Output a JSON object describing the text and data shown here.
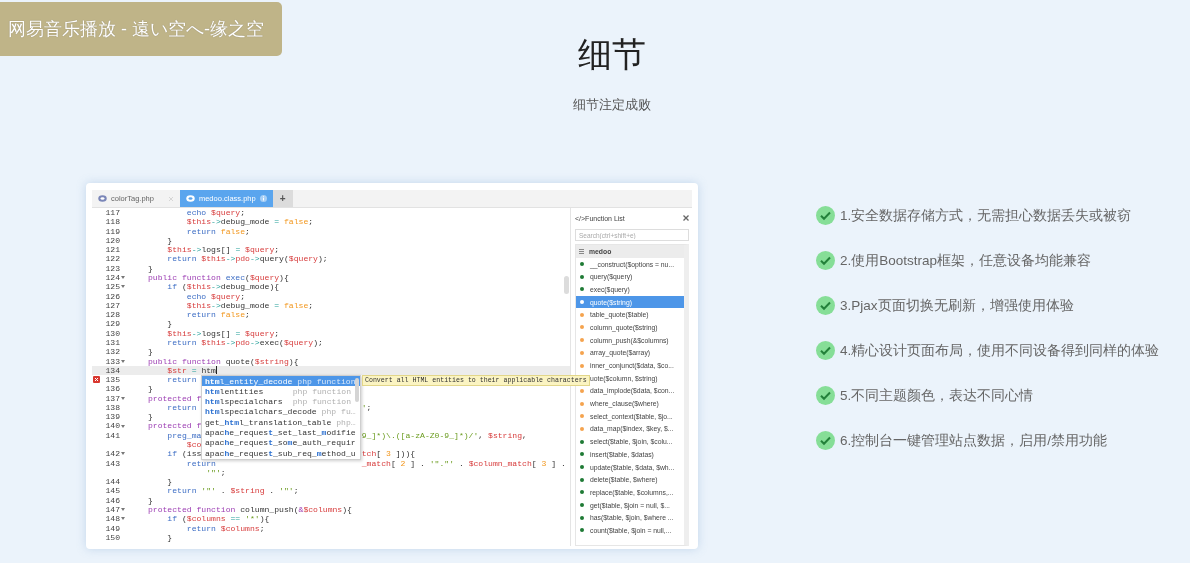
{
  "notification": {
    "text": "网易音乐播放 - 遠い空へ-缘之空"
  },
  "heading": {
    "title": "细节",
    "subtitle": "细节注定成败"
  },
  "editor": {
    "tabs": [
      {
        "label": "colorTag.php",
        "selected": false
      },
      {
        "label": "medoo.class.php",
        "selected": true
      }
    ],
    "new_tab": "+",
    "lines": [
      {
        "kind": "line",
        "number": "117",
        "foldable": false,
        "active": false,
        "error": false,
        "tokens": [
          {
            "kind": "control",
            "text": "            echo "
          },
          {
            "kind": "variable",
            "text": "$query"
          },
          {
            "kind": "plain",
            "text": ";"
          }
        ]
      },
      {
        "kind": "line",
        "number": "118",
        "foldable": false,
        "active": false,
        "error": false,
        "tokens": [
          {
            "kind": "variable",
            "text": "            $this"
          },
          {
            "kind": "operator",
            "text": "->"
          },
          {
            "kind": "plain",
            "text": "debug_mode "
          },
          {
            "kind": "operator",
            "text": "= "
          },
          {
            "kind": "literal",
            "text": "false"
          },
          {
            "kind": "plain",
            "text": ";"
          }
        ]
      },
      {
        "kind": "line",
        "number": "119",
        "foldable": false,
        "active": false,
        "error": false,
        "tokens": [
          {
            "kind": "control",
            "text": "            return "
          },
          {
            "kind": "literal",
            "text": "false"
          },
          {
            "kind": "plain",
            "text": ";"
          }
        ]
      },
      {
        "kind": "line",
        "number": "120",
        "foldable": false,
        "active": false,
        "error": false,
        "tokens": [
          {
            "kind": "plain",
            "text": "        }"
          }
        ]
      },
      {
        "kind": "line",
        "number": "121",
        "foldable": false,
        "active": false,
        "error": false,
        "tokens": [
          {
            "kind": "variable",
            "text": "        $this"
          },
          {
            "kind": "operator",
            "text": "->"
          },
          {
            "kind": "plain",
            "text": "logs[] "
          },
          {
            "kind": "operator",
            "text": "= "
          },
          {
            "kind": "variable",
            "text": "$query"
          },
          {
            "kind": "plain",
            "text": ";"
          }
        ]
      },
      {
        "kind": "line",
        "number": "122",
        "foldable": false,
        "active": false,
        "error": false,
        "tokens": [
          {
            "kind": "control",
            "text": "        return "
          },
          {
            "kind": "variable",
            "text": "$this"
          },
          {
            "kind": "operator",
            "text": "->"
          },
          {
            "kind": "variable",
            "text": "pdo"
          },
          {
            "kind": "operator",
            "text": "->"
          },
          {
            "kind": "plain",
            "text": "query("
          },
          {
            "kind": "variable",
            "text": "$query"
          },
          {
            "kind": "plain",
            "text": ");"
          }
        ]
      },
      {
        "kind": "line",
        "number": "123",
        "foldable": false,
        "active": false,
        "error": false,
        "tokens": [
          {
            "kind": "plain",
            "text": "    }"
          }
        ]
      },
      {
        "kind": "line",
        "number": "124",
        "foldable": true,
        "active": false,
        "error": false,
        "tokens": [
          {
            "kind": "keyword",
            "text": "    public function "
          },
          {
            "kind": "name",
            "text": "exec"
          },
          {
            "kind": "plain",
            "text": "("
          },
          {
            "kind": "variable",
            "text": "$query"
          },
          {
            "kind": "plain",
            "text": "){"
          }
        ]
      },
      {
        "kind": "line",
        "number": "125",
        "foldable": true,
        "active": false,
        "error": false,
        "tokens": [
          {
            "kind": "control",
            "text": "        if "
          },
          {
            "kind": "plain",
            "text": "("
          },
          {
            "kind": "variable",
            "text": "$this"
          },
          {
            "kind": "operator",
            "text": "->"
          },
          {
            "kind": "plain",
            "text": "debug_mode){"
          }
        ]
      },
      {
        "kind": "line",
        "number": "126",
        "foldable": false,
        "active": false,
        "error": false,
        "tokens": [
          {
            "kind": "control",
            "text": "            echo "
          },
          {
            "kind": "variable",
            "text": "$query"
          },
          {
            "kind": "plain",
            "text": ";"
          }
        ]
      },
      {
        "kind": "line",
        "number": "127",
        "foldable": false,
        "active": false,
        "error": false,
        "tokens": [
          {
            "kind": "variable",
            "text": "            $this"
          },
          {
            "kind": "operator",
            "text": "->"
          },
          {
            "kind": "plain",
            "text": "debug_mode "
          },
          {
            "kind": "operator",
            "text": "= "
          },
          {
            "kind": "literal",
            "text": "false"
          },
          {
            "kind": "plain",
            "text": ";"
          }
        ]
      },
      {
        "kind": "line",
        "number": "128",
        "foldable": false,
        "active": false,
        "error": false,
        "tokens": [
          {
            "kind": "control",
            "text": "            return "
          },
          {
            "kind": "literal",
            "text": "false"
          },
          {
            "kind": "plain",
            "text": ";"
          }
        ]
      },
      {
        "kind": "line",
        "number": "129",
        "foldable": false,
        "active": false,
        "error": false,
        "tokens": [
          {
            "kind": "plain",
            "text": "        }"
          }
        ]
      },
      {
        "kind": "line",
        "number": "130",
        "foldable": false,
        "active": false,
        "error": false,
        "tokens": [
          {
            "kind": "variable",
            "text": "        $this"
          },
          {
            "kind": "operator",
            "text": "->"
          },
          {
            "kind": "plain",
            "text": "logs[] "
          },
          {
            "kind": "operator",
            "text": "= "
          },
          {
            "kind": "variable",
            "text": "$query"
          },
          {
            "kind": "plain",
            "text": ";"
          }
        ]
      },
      {
        "kind": "line",
        "number": "131",
        "foldable": false,
        "active": false,
        "error": false,
        "tokens": [
          {
            "kind": "control",
            "text": "        return "
          },
          {
            "kind": "variable",
            "text": "$this"
          },
          {
            "kind": "operator",
            "text": "->"
          },
          {
            "kind": "variable",
            "text": "pdo"
          },
          {
            "kind": "operator",
            "text": "->"
          },
          {
            "kind": "plain",
            "text": "exec("
          },
          {
            "kind": "variable",
            "text": "$query"
          },
          {
            "kind": "plain",
            "text": ");"
          }
        ]
      },
      {
        "kind": "line",
        "number": "132",
        "foldable": false,
        "active": false,
        "error": false,
        "tokens": [
          {
            "kind": "plain",
            "text": "    }"
          }
        ]
      },
      {
        "kind": "line",
        "number": "133",
        "foldable": true,
        "active": false,
        "error": false,
        "tokens": [
          {
            "kind": "keyword",
            "text": "    public function "
          },
          {
            "kind": "plain",
            "text": "quote("
          },
          {
            "kind": "variable",
            "text": "$string"
          },
          {
            "kind": "plain",
            "text": "){"
          }
        ]
      },
      {
        "kind": "line",
        "number": "134",
        "foldable": false,
        "active": true,
        "error": false,
        "tokens": [
          {
            "kind": "variable",
            "text": "        $str "
          },
          {
            "kind": "operator",
            "text": "= "
          },
          {
            "kind": "plain",
            "text": "htm"
          }
        ]
      },
      {
        "kind": "line",
        "number": "135",
        "foldable": false,
        "active": false,
        "error": true,
        "tokens": [
          {
            "kind": "control",
            "text": "        return"
          }
        ]
      },
      {
        "kind": "line",
        "number": "136",
        "foldable": false,
        "active": false,
        "error": false,
        "tokens": [
          {
            "kind": "plain",
            "text": "    }"
          }
        ]
      },
      {
        "kind": "line",
        "number": "137",
        "foldable": true,
        "active": false,
        "error": false,
        "tokens": [
          {
            "kind": "keyword",
            "text": "    protected f"
          }
        ]
      },
      {
        "kind": "line",
        "number": "138",
        "foldable": false,
        "active": false,
        "error": false,
        "tokens": [
          {
            "kind": "control",
            "text": "        return"
          }
        ],
        "tail": [
          {
            "kind": "string",
            "text": "'"
          },
          {
            "kind": "plain",
            "text": ";"
          }
        ]
      },
      {
        "kind": "line",
        "number": "139",
        "foldable": false,
        "active": false,
        "error": false,
        "tokens": [
          {
            "kind": "plain",
            "text": "    }"
          }
        ]
      },
      {
        "kind": "line",
        "number": "140",
        "foldable": true,
        "active": false,
        "error": false,
        "tokens": [
          {
            "kind": "keyword",
            "text": "    protected f"
          }
        ]
      },
      {
        "kind": "line",
        "number": "141",
        "foldable": false,
        "active": false,
        "error": false,
        "tokens": [
          {
            "kind": "control",
            "text": "        preg_ma"
          }
        ],
        "tail": [
          {
            "kind": "string",
            "text": "9_]*)\\.([a-zA-Z0-9_]*)/'"
          },
          {
            "kind": "plain",
            "text": ", "
          },
          {
            "kind": "variable",
            "text": "$string"
          },
          {
            "kind": "plain",
            "text": ","
          }
        ]
      },
      {
        "kind": "continuation",
        "tokens": [
          {
            "kind": "variable",
            "text": "            $co"
          }
        ]
      },
      {
        "kind": "line",
        "number": "142",
        "foldable": true,
        "active": false,
        "error": false,
        "tokens": [
          {
            "kind": "control",
            "text": "        if "
          },
          {
            "kind": "plain",
            "text": "(iss"
          }
        ],
        "tail": [
          {
            "kind": "variable",
            "text": "tch"
          },
          {
            "kind": "plain",
            "text": "[ "
          },
          {
            "kind": "literal",
            "text": "3"
          },
          {
            "kind": "plain",
            "text": " ])){"
          }
        ]
      },
      {
        "kind": "line",
        "number": "143",
        "foldable": false,
        "active": false,
        "error": false,
        "tokens": [
          {
            "kind": "control",
            "text": "            return"
          }
        ],
        "tail": [
          {
            "kind": "variable",
            "text": "_match"
          },
          {
            "kind": "plain",
            "text": "[ "
          },
          {
            "kind": "literal",
            "text": "2"
          },
          {
            "kind": "plain",
            "text": " ] . "
          },
          {
            "kind": "string",
            "text": "'\".\"'"
          },
          {
            "kind": "plain",
            "text": " . "
          },
          {
            "kind": "variable",
            "text": "$column_match"
          },
          {
            "kind": "plain",
            "text": "[ "
          },
          {
            "kind": "literal",
            "text": "3"
          },
          {
            "kind": "plain",
            "text": " ] ."
          }
        ]
      },
      {
        "kind": "continuation",
        "tokens": [
          {
            "kind": "string",
            "text": "                '\"'"
          },
          {
            "kind": "plain",
            "text": ";"
          }
        ]
      },
      {
        "kind": "line",
        "number": "144",
        "foldable": false,
        "active": false,
        "error": false,
        "tokens": [
          {
            "kind": "plain",
            "text": "        }"
          }
        ]
      },
      {
        "kind": "line",
        "number": "145",
        "foldable": false,
        "active": false,
        "error": false,
        "tokens": [
          {
            "kind": "control",
            "text": "        return "
          },
          {
            "kind": "string",
            "text": "'\"'"
          },
          {
            "kind": "plain",
            "text": " . "
          },
          {
            "kind": "variable",
            "text": "$string"
          },
          {
            "kind": "plain",
            "text": " . "
          },
          {
            "kind": "string",
            "text": "'\"'"
          },
          {
            "kind": "plain",
            "text": ";"
          }
        ]
      },
      {
        "kind": "line",
        "number": "146",
        "foldable": false,
        "active": false,
        "error": false,
        "tokens": [
          {
            "kind": "plain",
            "text": "    }"
          }
        ]
      },
      {
        "kind": "line",
        "number": "147",
        "foldable": true,
        "active": false,
        "error": false,
        "tokens": [
          {
            "kind": "keyword",
            "text": "    protected function "
          },
          {
            "kind": "plain",
            "text": "column_push("
          },
          {
            "kind": "keyword",
            "text": "&"
          },
          {
            "kind": "variable",
            "text": "$columns"
          },
          {
            "kind": "plain",
            "text": "){"
          }
        ]
      },
      {
        "kind": "line",
        "number": "148",
        "foldable": true,
        "active": false,
        "error": false,
        "tokens": [
          {
            "kind": "control",
            "text": "        if "
          },
          {
            "kind": "plain",
            "text": "("
          },
          {
            "kind": "variable",
            "text": "$columns "
          },
          {
            "kind": "operator",
            "text": "== "
          },
          {
            "kind": "string",
            "text": "'*'"
          },
          {
            "kind": "plain",
            "text": "){"
          }
        ]
      },
      {
        "kind": "line",
        "number": "149",
        "foldable": false,
        "active": false,
        "error": false,
        "tokens": [
          {
            "kind": "control",
            "text": "            return "
          },
          {
            "kind": "variable",
            "text": "$columns"
          },
          {
            "kind": "plain",
            "text": ";"
          }
        ]
      },
      {
        "kind": "line",
        "number": "150",
        "foldable": false,
        "active": false,
        "error": false,
        "tokens": [
          {
            "kind": "plain",
            "text": "        }"
          }
        ]
      }
    ],
    "autocomplete": {
      "items": [
        {
          "name": "**htm**l_entity_decode",
          "type": "php function",
          "selected": true
        },
        {
          "name": "**htm**lentities",
          "type": "php function",
          "selected": false
        },
        {
          "name": "**htm**lspecialchars",
          "type": "php function",
          "selected": false
        },
        {
          "name": "**htm**lspecialchars_decode",
          "type": "php fu…",
          "selected": false
        },
        {
          "name": "get_**htm**l_translation_table",
          "type": "php…",
          "selected": false
        },
        {
          "name": "apac**h**e_reques**t**_set_last_**m**odifie",
          "selected": false
        },
        {
          "name": "apac**h**e_reques**t**_so**m**e_auth_requir",
          "selected": false
        },
        {
          "name": "apac**h**e_reques**t**_sub_req_**m**ethod_u",
          "selected": false
        }
      ],
      "tooltip": "Convert all HTML entities to their applicable characters"
    },
    "function_list": {
      "title": "</>Function List",
      "search": {
        "placeholder": "Search(ctrl+shift+e)"
      },
      "group": "medoo",
      "items": [
        {
          "label": "__construct($options = nu...",
          "color": "#1e7a35",
          "selected": false
        },
        {
          "label": "query($query)",
          "color": "#1e7a35",
          "selected": false
        },
        {
          "label": "exec($query)",
          "color": "#1e7a35",
          "selected": false
        },
        {
          "label": "quote($string)",
          "color": "#ffffff",
          "selected": true
        },
        {
          "label": "table_quote($table)",
          "color": "#f5a34e",
          "selected": false
        },
        {
          "label": "column_quote($string)",
          "color": "#f5a34e",
          "selected": false
        },
        {
          "label": "column_push(&$columns)",
          "color": "#f5a34e",
          "selected": false
        },
        {
          "label": "array_quote($array)",
          "color": "#f5a34e",
          "selected": false
        },
        {
          "label": "inner_conjunct($data, $co...",
          "color": "#f5a34e",
          "selected": false
        },
        {
          "label": "uote($column, $string)",
          "selected": false
        },
        {
          "label": "data_implode($data, $con...",
          "color": "#f5a34e",
          "selected": false
        },
        {
          "label": "where_clause($where)",
          "color": "#f5a34e",
          "selected": false
        },
        {
          "label": "select_context($table, $jo...",
          "color": "#f5a34e",
          "selected": false
        },
        {
          "label": "data_map($index, $key, $...",
          "color": "#f5a34e",
          "selected": false
        },
        {
          "label": "select($table, $join, $colu...",
          "color": "#1e7a35",
          "selected": false
        },
        {
          "label": "insert($table, $datas)",
          "color": "#1e7a35",
          "selected": false
        },
        {
          "label": "update($table, $data, $wh...",
          "color": "#1e7a35",
          "selected": false
        },
        {
          "label": "delete($table, $where)",
          "color": "#1e7a35",
          "selected": false
        },
        {
          "label": "replace($table, $columns,...",
          "color": "#1e7a35",
          "selected": false
        },
        {
          "label": "get($table, $join = null, $...",
          "color": "#1e7a35",
          "selected": false
        },
        {
          "label": "has($table, $join, $where ...",
          "color": "#1e7a35",
          "selected": false
        },
        {
          "label": "count($table, $join = null,...",
          "color": "#1e7a35",
          "selected": false
        }
      ]
    }
  },
  "features": [
    {
      "text": "1.安全数据存储方式，无需担心数据丢失或被窃"
    },
    {
      "text": "2.使用Bootstrap框架，任意设备均能兼容"
    },
    {
      "text": "3.Pjax页面切换无刷新，增强使用体验"
    },
    {
      "text": "4.精心设计页面布局，使用不同设备得到同样的体验"
    },
    {
      "text": "5.不同主题颜色，表达不同心情"
    },
    {
      "text": "6.控制台一键管理站点数据，启用/禁用功能"
    }
  ]
}
